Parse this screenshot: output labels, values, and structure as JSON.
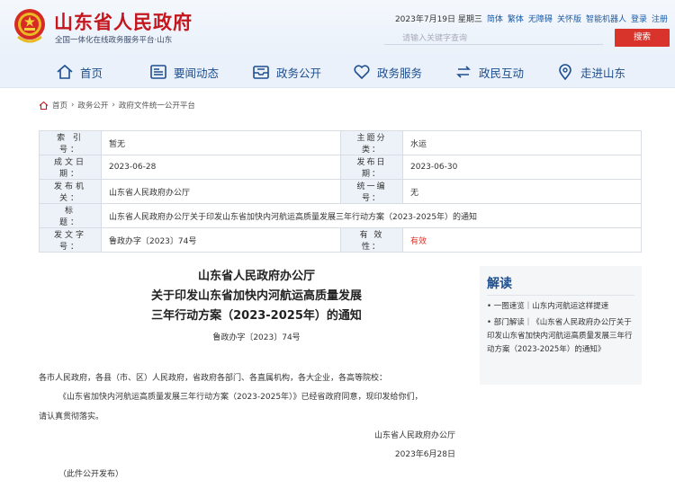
{
  "header": {
    "site_title": "山东省人民政府",
    "site_subtitle": "全国一体化在线政务服务平台·山东",
    "date": "2023年7月19日 星期三",
    "links": [
      "简体",
      "繁体",
      "无障碍",
      "关怀版",
      "智能机器人",
      "登录",
      "注册"
    ],
    "search_placeholder": "请输入关键字查询",
    "search_button": "搜索"
  },
  "nav": {
    "items": [
      {
        "label": "首页",
        "icon": "home-icon"
      },
      {
        "label": "要闻动态",
        "icon": "newspaper-icon"
      },
      {
        "label": "政务公开",
        "icon": "inbox-icon"
      },
      {
        "label": "政务服务",
        "icon": "heart-icon"
      },
      {
        "label": "政民互动",
        "icon": "exchange-icon"
      },
      {
        "label": "走进山东",
        "icon": "location-icon"
      }
    ]
  },
  "breadcrumb": [
    "首页",
    "政务公开",
    "政府文件统一公开平台"
  ],
  "info": {
    "index_label": "索 引 号：",
    "index_value": "暂无",
    "category_label": "主题分类：",
    "category_value": "水运",
    "date_label": "成文日期：",
    "date_value": "2023-06-28",
    "publish_label": "发布日期：",
    "publish_value": "2023-06-30",
    "issuer_label": "发布机关：",
    "issuer_value": "山东省人民政府办公厅",
    "number_label": "统一编号：",
    "number_value": "无",
    "title_label": "标　　题：",
    "title_value": "山东省人民政府办公厅关于印发山东省加快内河航运高质量发展三年行动方案（2023-2025年）的通知",
    "docno_label": "发文字号：",
    "docno_value": "鲁政办字〔2023〕74号",
    "validity_label": "有 效 性：",
    "validity_value": "有效"
  },
  "article": {
    "title_line1": "山东省人民政府办公厅",
    "title_line2": "关于印发山东省加快内河航运高质量发展",
    "title_line3": "三年行动方案（2023-2025年）的通知",
    "doc_no": "鲁政办字〔2023〕74号",
    "salutation": "各市人民政府，各县（市、区）人民政府，省政府各部门、各直属机构，各大企业，各高等院校：",
    "body1": "《山东省加快内河航运高质量发展三年行动方案（2023-2025年）》已经省政府同意，现印发给你们，",
    "body2": "请认真贯彻落实。",
    "signer": "山东省人民政府办公厅",
    "sign_date": "2023年6月28日",
    "footnote": "（此件公开发布）"
  },
  "sidebar": {
    "title": "解读",
    "item1": "一图速览｜山东内河航运这样提速",
    "item2": "部门解读｜《山东省人民政府办公厅关于印发山东省加快内河航运高质量发展三年行动方案（2023-2025年）的通知》"
  },
  "colors": {
    "brand_red": "#c4161c",
    "nav_blue": "#1d4e8f",
    "button_red": "#d9342b"
  }
}
